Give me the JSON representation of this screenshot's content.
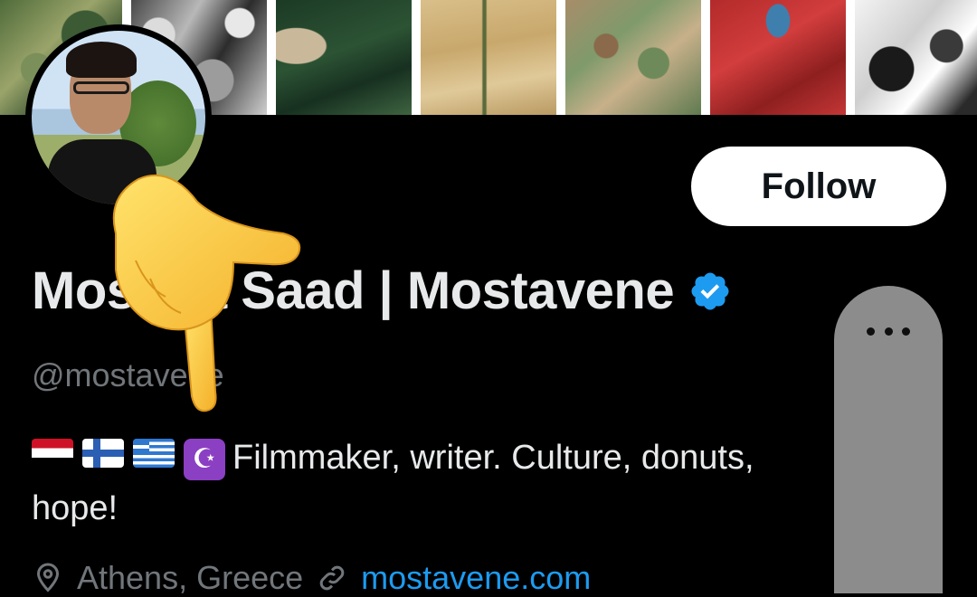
{
  "banner": {
    "tiles": [
      "satellite-forest",
      "satellite-grayscale",
      "satellite-river",
      "satellite-desert",
      "satellite-delta",
      "satellite-infrared",
      "satellite-snow"
    ]
  },
  "profile": {
    "follow_label": "Follow",
    "display_name": "Mostafa Saad | Mostavene",
    "handle": "@mostavene",
    "bio_text": "Filmmaker, writer. Culture, donuts, hope!",
    "bio_flags": [
      "egypt-flag-icon",
      "finland-flag-icon",
      "greece-flag-icon",
      "star-and-crescent-icon"
    ],
    "location": "Athens, Greece",
    "website": "mostavene.com",
    "verified_color": "#1d9bf0"
  },
  "overlay": {
    "more_menu": "more-options-icon",
    "pointer": "pointing-hand-emoji"
  }
}
